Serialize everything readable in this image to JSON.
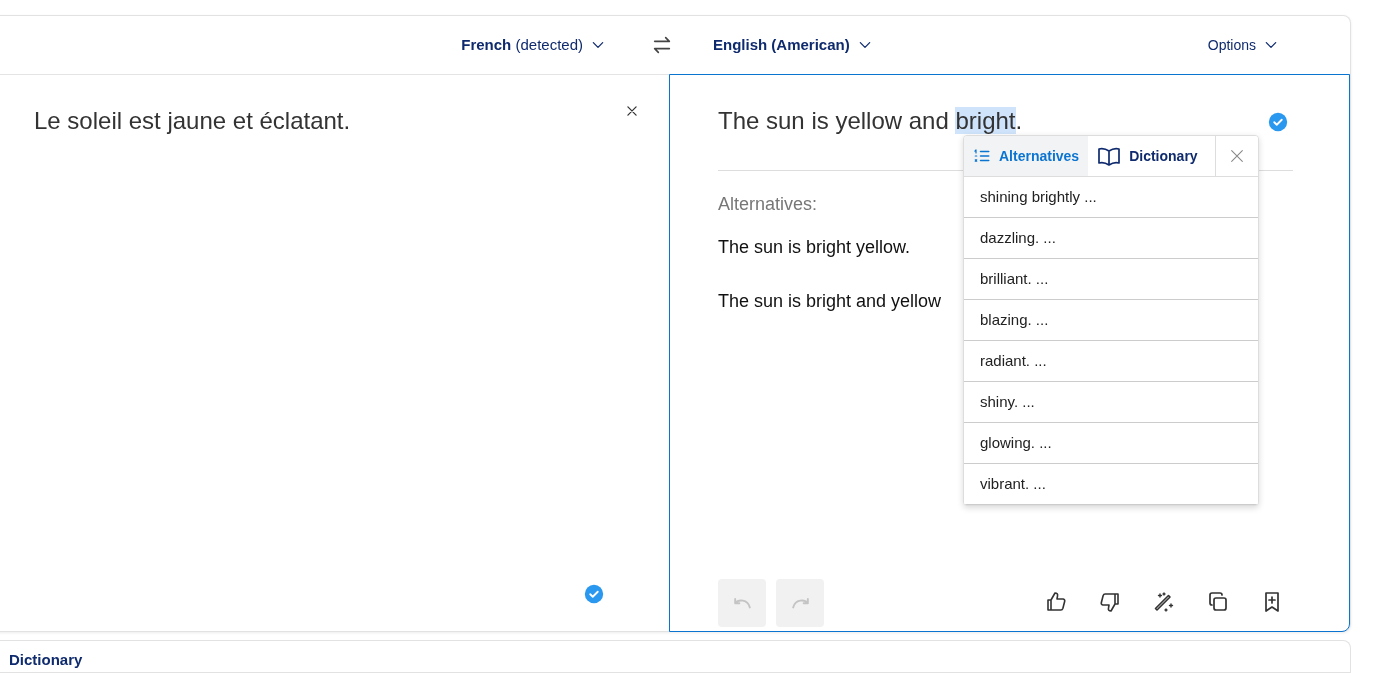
{
  "source_language": {
    "label": "French",
    "note": "(detected)"
  },
  "target_language": {
    "label": "English (American)"
  },
  "options": {
    "label": "Options"
  },
  "source": {
    "text": "Le soleil est jaune et éclatant.",
    "verified": true
  },
  "target": {
    "before": "The sun is yellow and ",
    "highlighted": "bright",
    "after": ".",
    "verified": true
  },
  "alternatives_heading": "Alternatives:",
  "alternatives": [
    "The sun is bright yellow.",
    "The sun is bright and yellow"
  ],
  "undo": {
    "disabled": true
  },
  "redo": {
    "disabled": true
  },
  "popup": {
    "tabs": [
      {
        "label": "Alternatives",
        "kind": "alternatives",
        "selected": true
      },
      {
        "label": "Dictionary",
        "kind": "dictionary",
        "selected": false
      }
    ],
    "items": [
      "shining brightly ...",
      "dazzling. ...",
      "brilliant. ...",
      "blazing. ...",
      "radiant. ...",
      "shiny. ...",
      "glowing. ...",
      "vibrant. ..."
    ]
  },
  "dictionary": {
    "title": "Dictionary"
  }
}
